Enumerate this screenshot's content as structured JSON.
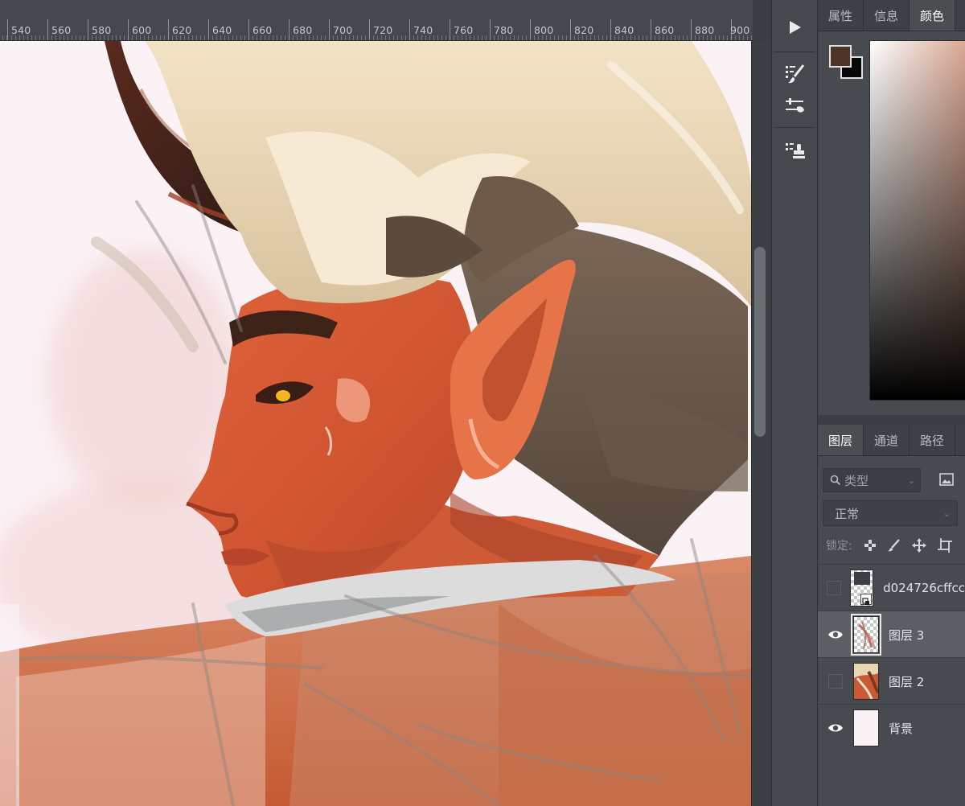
{
  "ruler": {
    "labels": [
      "540",
      "560",
      "580",
      "600",
      "620",
      "640",
      "660",
      "680",
      "700",
      "720",
      "740",
      "760",
      "780",
      "800",
      "820",
      "840",
      "860",
      "880",
      "900"
    ]
  },
  "toolbar": {
    "play_icon": "play-icon",
    "brush_preset_icon": "brush-settings-icon",
    "brush_mixer_icon": "brush-presets-icon",
    "clone_source_icon": "clone-source-icon"
  },
  "colors_panel": {
    "tabs": [
      "属性",
      "信息",
      "颜色"
    ],
    "active_tab": "颜色",
    "foreground_color": "#4e3527",
    "background_color": "#070707"
  },
  "layers_panel": {
    "tabs": [
      "图层",
      "通道",
      "路径"
    ],
    "active_tab": "图层",
    "filter_placeholder": "类型",
    "blend_mode": "正常",
    "lock_label": "锁定:",
    "layers": [
      {
        "name": "d024726cffcc",
        "visible": false,
        "selected": false
      },
      {
        "name": "图层 3",
        "visible": true,
        "selected": true
      },
      {
        "name": "图层 2",
        "visible": false,
        "selected": false
      },
      {
        "name": "背景",
        "visible": true,
        "selected": false
      }
    ]
  }
}
